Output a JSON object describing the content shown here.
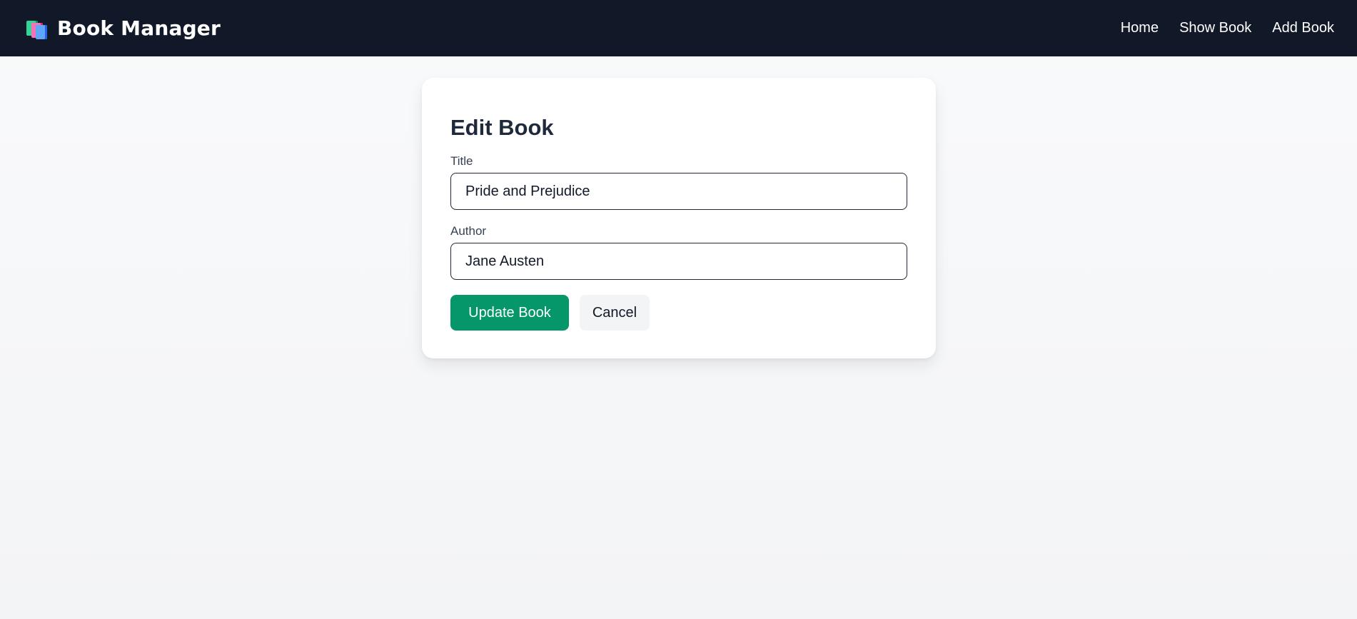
{
  "app": {
    "title": "Book Manager",
    "logo_icon": "books-icon"
  },
  "nav": {
    "items": [
      {
        "label": "Home"
      },
      {
        "label": "Show Book"
      },
      {
        "label": "Add Book"
      }
    ]
  },
  "form": {
    "heading": "Edit Book",
    "title_label": "Title",
    "title_value": "Pride and Prejudice",
    "author_label": "Author",
    "author_value": "Jane Austen",
    "submit_label": "Update Book",
    "cancel_label": "Cancel"
  },
  "colors": {
    "navbar_bg": "#111827",
    "primary": "#059669",
    "secondary_bg": "#f3f4f6"
  }
}
